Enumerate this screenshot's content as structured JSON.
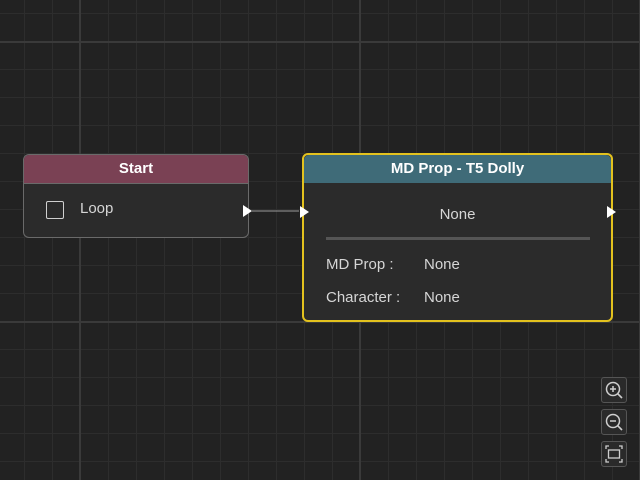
{
  "start_node": {
    "title": "Start",
    "loop_label": "Loop",
    "loop_checked": false,
    "header_color": "#7a4154"
  },
  "prop_node": {
    "title": "MD Prop - T5 Dolly",
    "selected_value": "None",
    "header_color": "#3f6b78",
    "selection_border_color": "#e3c21e",
    "fields": [
      {
        "label": "MD Prop :",
        "value": "None"
      },
      {
        "label": "Character :",
        "value": "None"
      }
    ]
  },
  "controls": {
    "zoom_in_icon": "zoom-in-icon",
    "zoom_out_icon": "zoom-out-icon",
    "fit_view_icon": "fit-view-icon"
  }
}
